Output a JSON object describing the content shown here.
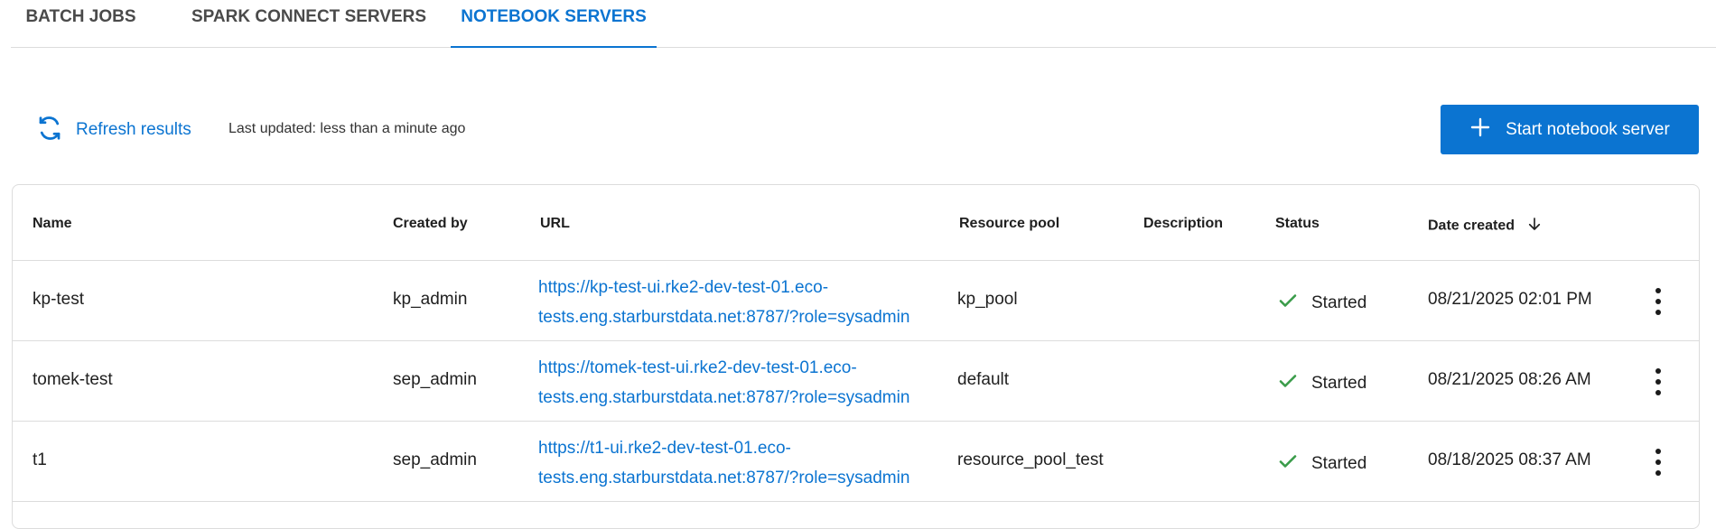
{
  "tabs": [
    {
      "label": "BATCH JOBS",
      "active": false
    },
    {
      "label": "SPARK CONNECT SERVERS",
      "active": false
    },
    {
      "label": "NOTEBOOK SERVERS",
      "active": true
    }
  ],
  "toolbar": {
    "refresh_label": "Refresh results",
    "last_updated": "Last updated: less than a minute ago",
    "start_label": "Start notebook server"
  },
  "table": {
    "headers": {
      "name": "Name",
      "created_by": "Created by",
      "url": "URL",
      "resource_pool": "Resource pool",
      "description": "Description",
      "status": "Status",
      "date_created": "Date created"
    },
    "rows": [
      {
        "name": "kp-test",
        "created_by": "kp_admin",
        "url": "https://kp-test-ui.rke2-dev-test-01.eco-tests.eng.starburstdata.net:8787/?role=sysadmin",
        "resource_pool": "kp_pool",
        "description": "",
        "status": "Started",
        "date_created": "08/21/2025 02:01 PM"
      },
      {
        "name": "tomek-test",
        "created_by": "sep_admin",
        "url": "https://tomek-test-ui.rke2-dev-test-01.eco-tests.eng.starburstdata.net:8787/?role=sysadmin",
        "resource_pool": "default",
        "description": "",
        "status": "Started",
        "date_created": "08/21/2025 08:26 AM"
      },
      {
        "name": "t1",
        "created_by": "sep_admin",
        "url": "https://t1-ui.rke2-dev-test-01.eco-tests.eng.starburstdata.net:8787/?role=sysadmin",
        "resource_pool": "resource_pool_test",
        "description": "",
        "status": "Started",
        "date_created": "08/18/2025 08:37 AM"
      }
    ]
  },
  "colors": {
    "accent": "#0b74d1",
    "success": "#3a9c4a",
    "border": "#dcdcdc"
  },
  "icons": {
    "refresh": "refresh-icon",
    "add": "plus-icon",
    "status": "check-icon",
    "sort": "arrow-down-icon",
    "menu": "more-vertical-icon"
  }
}
